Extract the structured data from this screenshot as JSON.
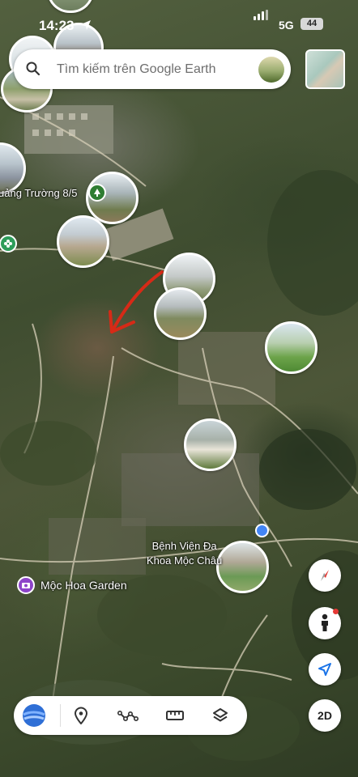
{
  "status_bar": {
    "time": "14:23",
    "network": "5G",
    "battery": "44"
  },
  "search": {
    "placeholder": "Tìm kiếm trên Google Earth"
  },
  "map": {
    "places": [
      {
        "label": "uảng Trường 8/5",
        "icon": "tree-icon",
        "color": "#2e7d32"
      },
      {
        "label": "Bệnh Viện Đa\nKhoa Mộc Châu",
        "icon": "hospital-icon",
        "color": "#c62828"
      },
      {
        "label": "Mộc Hoa Garden",
        "icon": "camera-icon",
        "color": "#8e44c9"
      }
    ]
  },
  "controls": {
    "view_mode": "2D"
  },
  "colors": {
    "accent_blue": "#4285f4",
    "arrow_red": "#d62a17"
  }
}
